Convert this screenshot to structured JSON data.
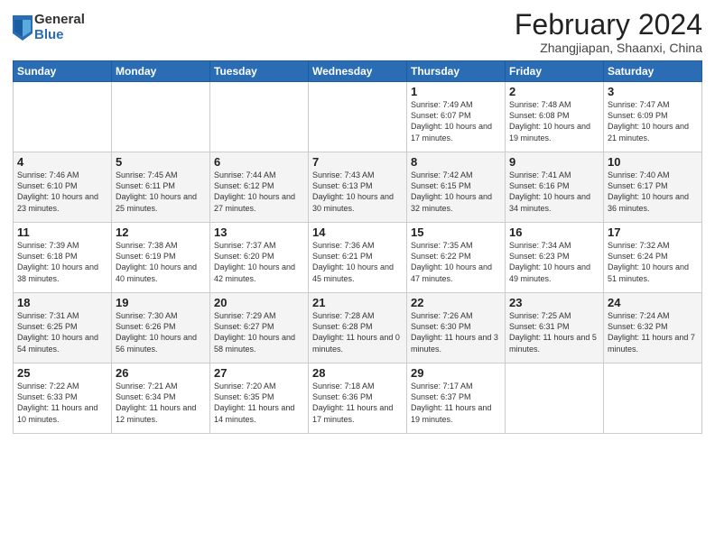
{
  "logo": {
    "general": "General",
    "blue": "Blue"
  },
  "title": "February 2024",
  "subtitle": "Zhangjiapan, Shaanxi, China",
  "headers": [
    "Sunday",
    "Monday",
    "Tuesday",
    "Wednesday",
    "Thursday",
    "Friday",
    "Saturday"
  ],
  "weeks": [
    [
      {
        "day": "",
        "info": ""
      },
      {
        "day": "",
        "info": ""
      },
      {
        "day": "",
        "info": ""
      },
      {
        "day": "",
        "info": ""
      },
      {
        "day": "1",
        "info": "Sunrise: 7:49 AM\nSunset: 6:07 PM\nDaylight: 10 hours\nand 17 minutes."
      },
      {
        "day": "2",
        "info": "Sunrise: 7:48 AM\nSunset: 6:08 PM\nDaylight: 10 hours\nand 19 minutes."
      },
      {
        "day": "3",
        "info": "Sunrise: 7:47 AM\nSunset: 6:09 PM\nDaylight: 10 hours\nand 21 minutes."
      }
    ],
    [
      {
        "day": "4",
        "info": "Sunrise: 7:46 AM\nSunset: 6:10 PM\nDaylight: 10 hours\nand 23 minutes."
      },
      {
        "day": "5",
        "info": "Sunrise: 7:45 AM\nSunset: 6:11 PM\nDaylight: 10 hours\nand 25 minutes."
      },
      {
        "day": "6",
        "info": "Sunrise: 7:44 AM\nSunset: 6:12 PM\nDaylight: 10 hours\nand 27 minutes."
      },
      {
        "day": "7",
        "info": "Sunrise: 7:43 AM\nSunset: 6:13 PM\nDaylight: 10 hours\nand 30 minutes."
      },
      {
        "day": "8",
        "info": "Sunrise: 7:42 AM\nSunset: 6:15 PM\nDaylight: 10 hours\nand 32 minutes."
      },
      {
        "day": "9",
        "info": "Sunrise: 7:41 AM\nSunset: 6:16 PM\nDaylight: 10 hours\nand 34 minutes."
      },
      {
        "day": "10",
        "info": "Sunrise: 7:40 AM\nSunset: 6:17 PM\nDaylight: 10 hours\nand 36 minutes."
      }
    ],
    [
      {
        "day": "11",
        "info": "Sunrise: 7:39 AM\nSunset: 6:18 PM\nDaylight: 10 hours\nand 38 minutes."
      },
      {
        "day": "12",
        "info": "Sunrise: 7:38 AM\nSunset: 6:19 PM\nDaylight: 10 hours\nand 40 minutes."
      },
      {
        "day": "13",
        "info": "Sunrise: 7:37 AM\nSunset: 6:20 PM\nDaylight: 10 hours\nand 42 minutes."
      },
      {
        "day": "14",
        "info": "Sunrise: 7:36 AM\nSunset: 6:21 PM\nDaylight: 10 hours\nand 45 minutes."
      },
      {
        "day": "15",
        "info": "Sunrise: 7:35 AM\nSunset: 6:22 PM\nDaylight: 10 hours\nand 47 minutes."
      },
      {
        "day": "16",
        "info": "Sunrise: 7:34 AM\nSunset: 6:23 PM\nDaylight: 10 hours\nand 49 minutes."
      },
      {
        "day": "17",
        "info": "Sunrise: 7:32 AM\nSunset: 6:24 PM\nDaylight: 10 hours\nand 51 minutes."
      }
    ],
    [
      {
        "day": "18",
        "info": "Sunrise: 7:31 AM\nSunset: 6:25 PM\nDaylight: 10 hours\nand 54 minutes."
      },
      {
        "day": "19",
        "info": "Sunrise: 7:30 AM\nSunset: 6:26 PM\nDaylight: 10 hours\nand 56 minutes."
      },
      {
        "day": "20",
        "info": "Sunrise: 7:29 AM\nSunset: 6:27 PM\nDaylight: 10 hours\nand 58 minutes."
      },
      {
        "day": "21",
        "info": "Sunrise: 7:28 AM\nSunset: 6:28 PM\nDaylight: 11 hours\nand 0 minutes."
      },
      {
        "day": "22",
        "info": "Sunrise: 7:26 AM\nSunset: 6:30 PM\nDaylight: 11 hours\nand 3 minutes."
      },
      {
        "day": "23",
        "info": "Sunrise: 7:25 AM\nSunset: 6:31 PM\nDaylight: 11 hours\nand 5 minutes."
      },
      {
        "day": "24",
        "info": "Sunrise: 7:24 AM\nSunset: 6:32 PM\nDaylight: 11 hours\nand 7 minutes."
      }
    ],
    [
      {
        "day": "25",
        "info": "Sunrise: 7:22 AM\nSunset: 6:33 PM\nDaylight: 11 hours\nand 10 minutes."
      },
      {
        "day": "26",
        "info": "Sunrise: 7:21 AM\nSunset: 6:34 PM\nDaylight: 11 hours\nand 12 minutes."
      },
      {
        "day": "27",
        "info": "Sunrise: 7:20 AM\nSunset: 6:35 PM\nDaylight: 11 hours\nand 14 minutes."
      },
      {
        "day": "28",
        "info": "Sunrise: 7:18 AM\nSunset: 6:36 PM\nDaylight: 11 hours\nand 17 minutes."
      },
      {
        "day": "29",
        "info": "Sunrise: 7:17 AM\nSunset: 6:37 PM\nDaylight: 11 hours\nand 19 minutes."
      },
      {
        "day": "",
        "info": ""
      },
      {
        "day": "",
        "info": ""
      }
    ]
  ]
}
